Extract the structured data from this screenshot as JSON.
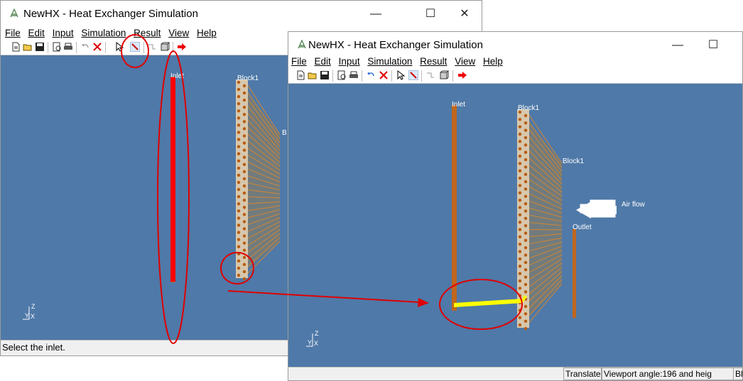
{
  "app": {
    "title": "NewHX - Heat Exchanger Simulation"
  },
  "menu": {
    "file": "File",
    "edit": "Edit",
    "input": "Input",
    "simulation": "Simulation",
    "result": "Result",
    "view": "View",
    "help": "Help"
  },
  "window_controls": {
    "minimize": "—",
    "maximize": "☐",
    "close": "✕"
  },
  "viewport": {
    "inlet": "Inlet",
    "block1": "Block1",
    "block_letter": "B",
    "outlet": "Outlet",
    "air_flow": "Air flow"
  },
  "axes": {
    "z": "Z",
    "y": "Y",
    "x": "X"
  },
  "status": {
    "select_inlet": "Select the inlet.",
    "translate": "Translate",
    "viewport_angle": "Viewport angle:196 and heig",
    "bl": "Bl"
  },
  "colors": {
    "canvas": "#4f79a8",
    "pipe": "#c0661e",
    "annotation": "#ff0000",
    "highlight": "#ffff00"
  },
  "icons": [
    "new-file-icon",
    "open-folder-icon",
    "save-icon",
    "print-preview-icon",
    "print-icon",
    "undo-icon",
    "delete-icon",
    "select-arrow-icon",
    "draw-pipe-icon",
    "connect-icon",
    "block-icon",
    "run-arrow-icon"
  ]
}
